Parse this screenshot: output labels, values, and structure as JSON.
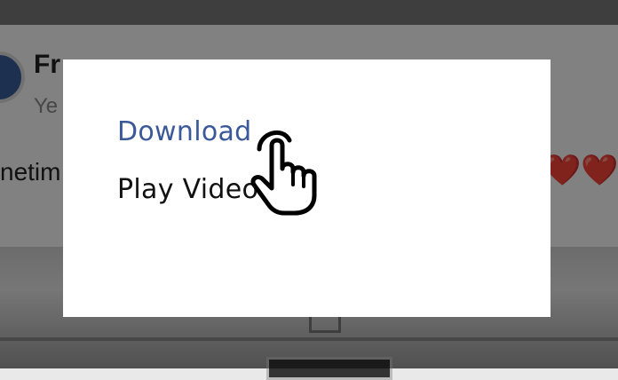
{
  "background": {
    "author_name": "Fr",
    "post_sub": "Ye",
    "post_text": "netim",
    "hearts": "❤️❤️"
  },
  "dialog": {
    "items": [
      {
        "label": "Download",
        "color": "#3b5998",
        "highlighted": true
      },
      {
        "label": "Play Video",
        "color": "#111111",
        "highlighted": false
      }
    ]
  },
  "cursor": {
    "icon": "pointing-hand-icon"
  },
  "colors": {
    "accent": "#3b5998",
    "overlay": "rgba(0,0,0,0.48)"
  }
}
